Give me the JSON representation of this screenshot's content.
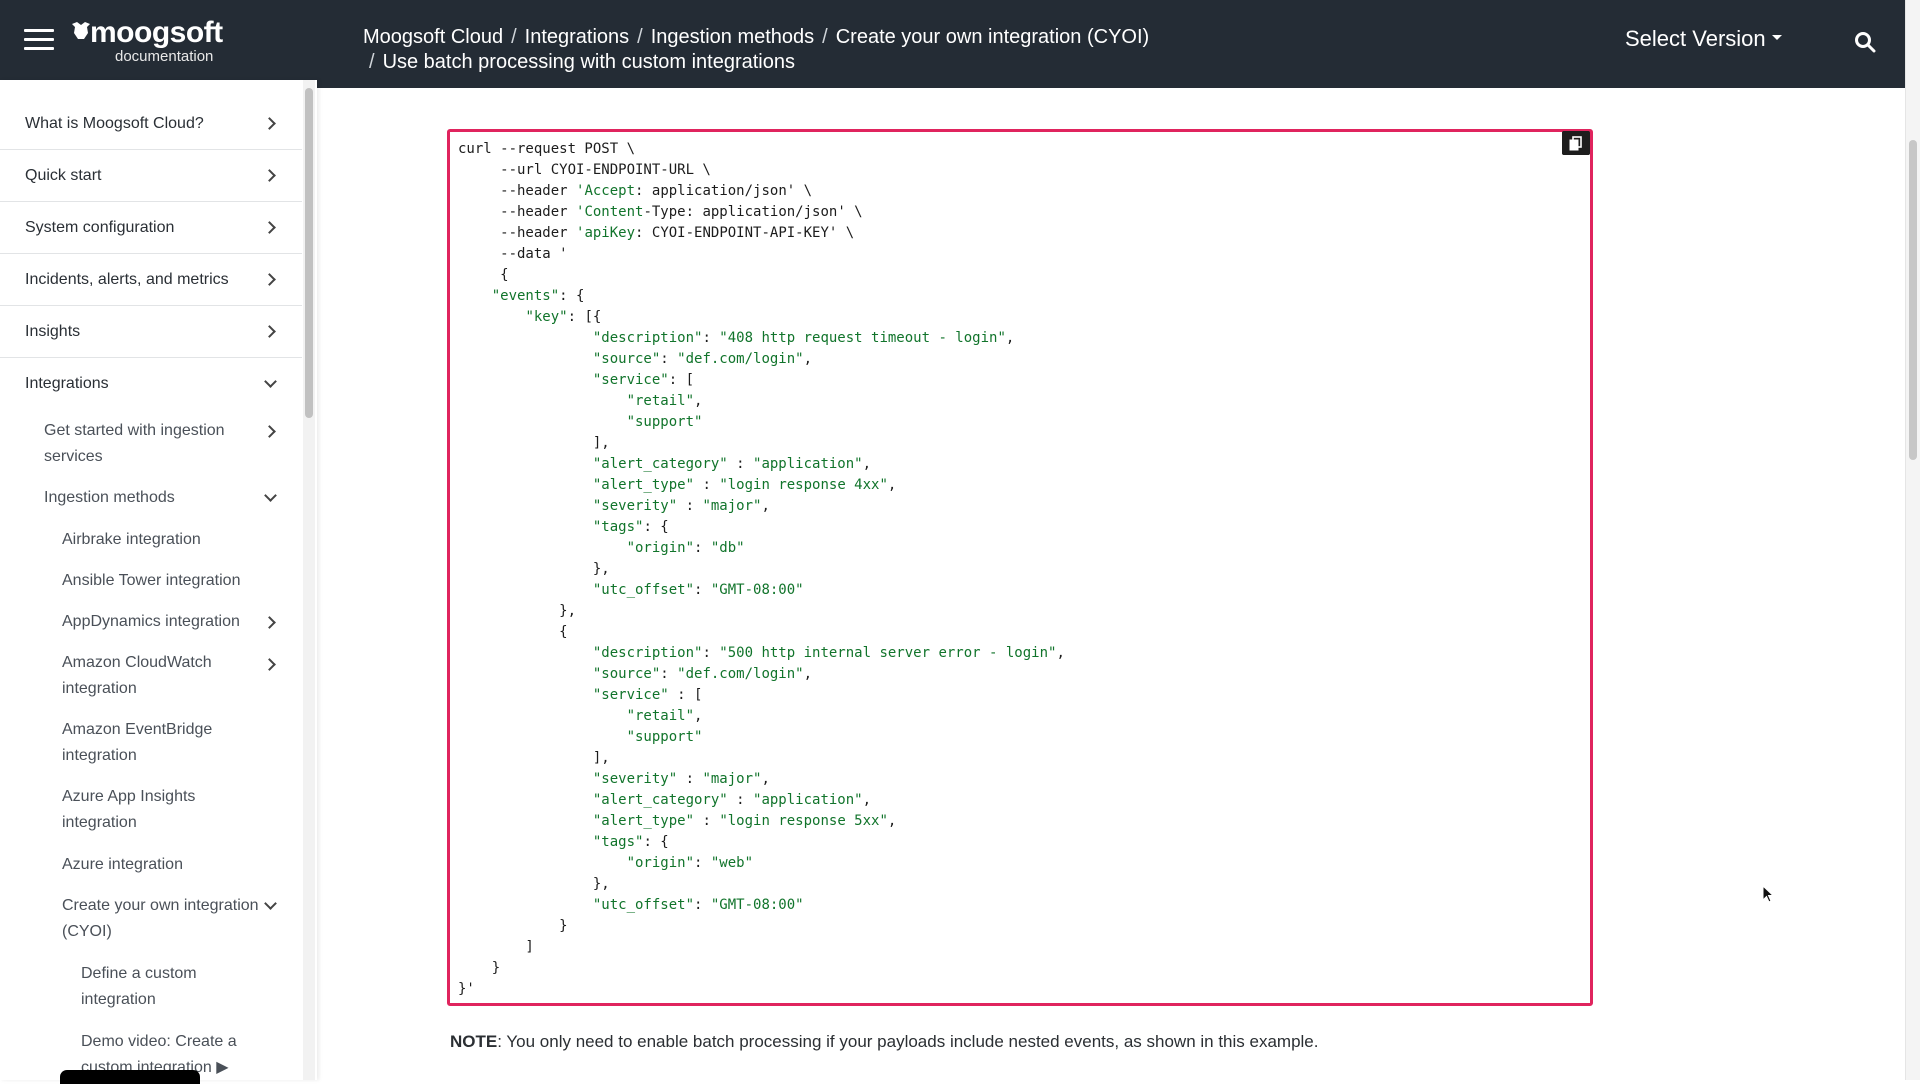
{
  "header": {
    "logo": {
      "word": "moogsoft",
      "sub": "documentation"
    },
    "breadcrumb": {
      "items": [
        "Moogsoft Cloud",
        "Integrations",
        "Ingestion methods",
        "Create your own integration (CYOI)"
      ],
      "current": "Use batch processing with custom integrations"
    },
    "version_label": "Select Version"
  },
  "sidebar": {
    "top_items": [
      "What is Moogsoft Cloud?",
      "Quick start",
      "System configuration",
      "Incidents, alerts, and metrics",
      "Insights",
      "Integrations"
    ],
    "sub_items": [
      "Get started with ingestion services",
      "Ingestion methods",
      "Airbrake integration",
      "Ansible Tower integration",
      "AppDynamics integration",
      "Amazon CloudWatch integration",
      "Amazon EventBridge integration",
      "Azure App Insights integration",
      "Azure integration",
      "Create your own integration (CYOI)",
      "Define a custom integration",
      "Demo video: Create a custom integration"
    ]
  },
  "code": {
    "lines": [
      "curl --request POST \\",
      "     --url CYOI-ENDPOINT-URL \\",
      "     --header 'Accept: application/json' \\",
      "     --header 'Content-Type: application/json' \\",
      "     --header 'apiKey: CYOI-ENDPOINT-API-KEY' \\",
      "     --data '",
      "     {",
      "    \"events\": {",
      "        \"key\": [{",
      "                \"description\": \"408 http request timeout - login\",",
      "                \"source\": \"def.com/login\",",
      "                \"service\": [",
      "                    \"retail\",",
      "                    \"support\"",
      "                ],",
      "                \"alert_category\" : \"application\",",
      "                \"alert_type\" : \"login response 4xx\",",
      "                \"severity\" : \"major\",",
      "                \"tags\": {",
      "                    \"origin\": \"db\"",
      "                },",
      "                \"utc_offset\": \"GMT-08:00\"",
      "            },",
      "            {",
      "                \"description\": \"500 http internal server error - login\",",
      "                \"source\": \"def.com/login\",",
      "                \"service\" : [",
      "                    \"retail\",",
      "                    \"support\"",
      "                ],",
      "                \"severity\" : \"major\",",
      "                \"alert_category\" : \"application\",",
      "                \"alert_type\" : \"login response 5xx\",",
      "                \"tags\": {",
      "                    \"origin\": \"web\"",
      "                },",
      "                \"utc_offset\": \"GMT-08:00\"",
      "            }",
      "        ]",
      "    }",
      "}'"
    ]
  },
  "note": {
    "label": "NOTE",
    "text": ": You only need to enable batch processing if your payloads include nested events, as shown in this example."
  },
  "colors": {
    "header_bg": "#242c35",
    "code_border": "#e0245e",
    "string_green": "#11742b"
  }
}
